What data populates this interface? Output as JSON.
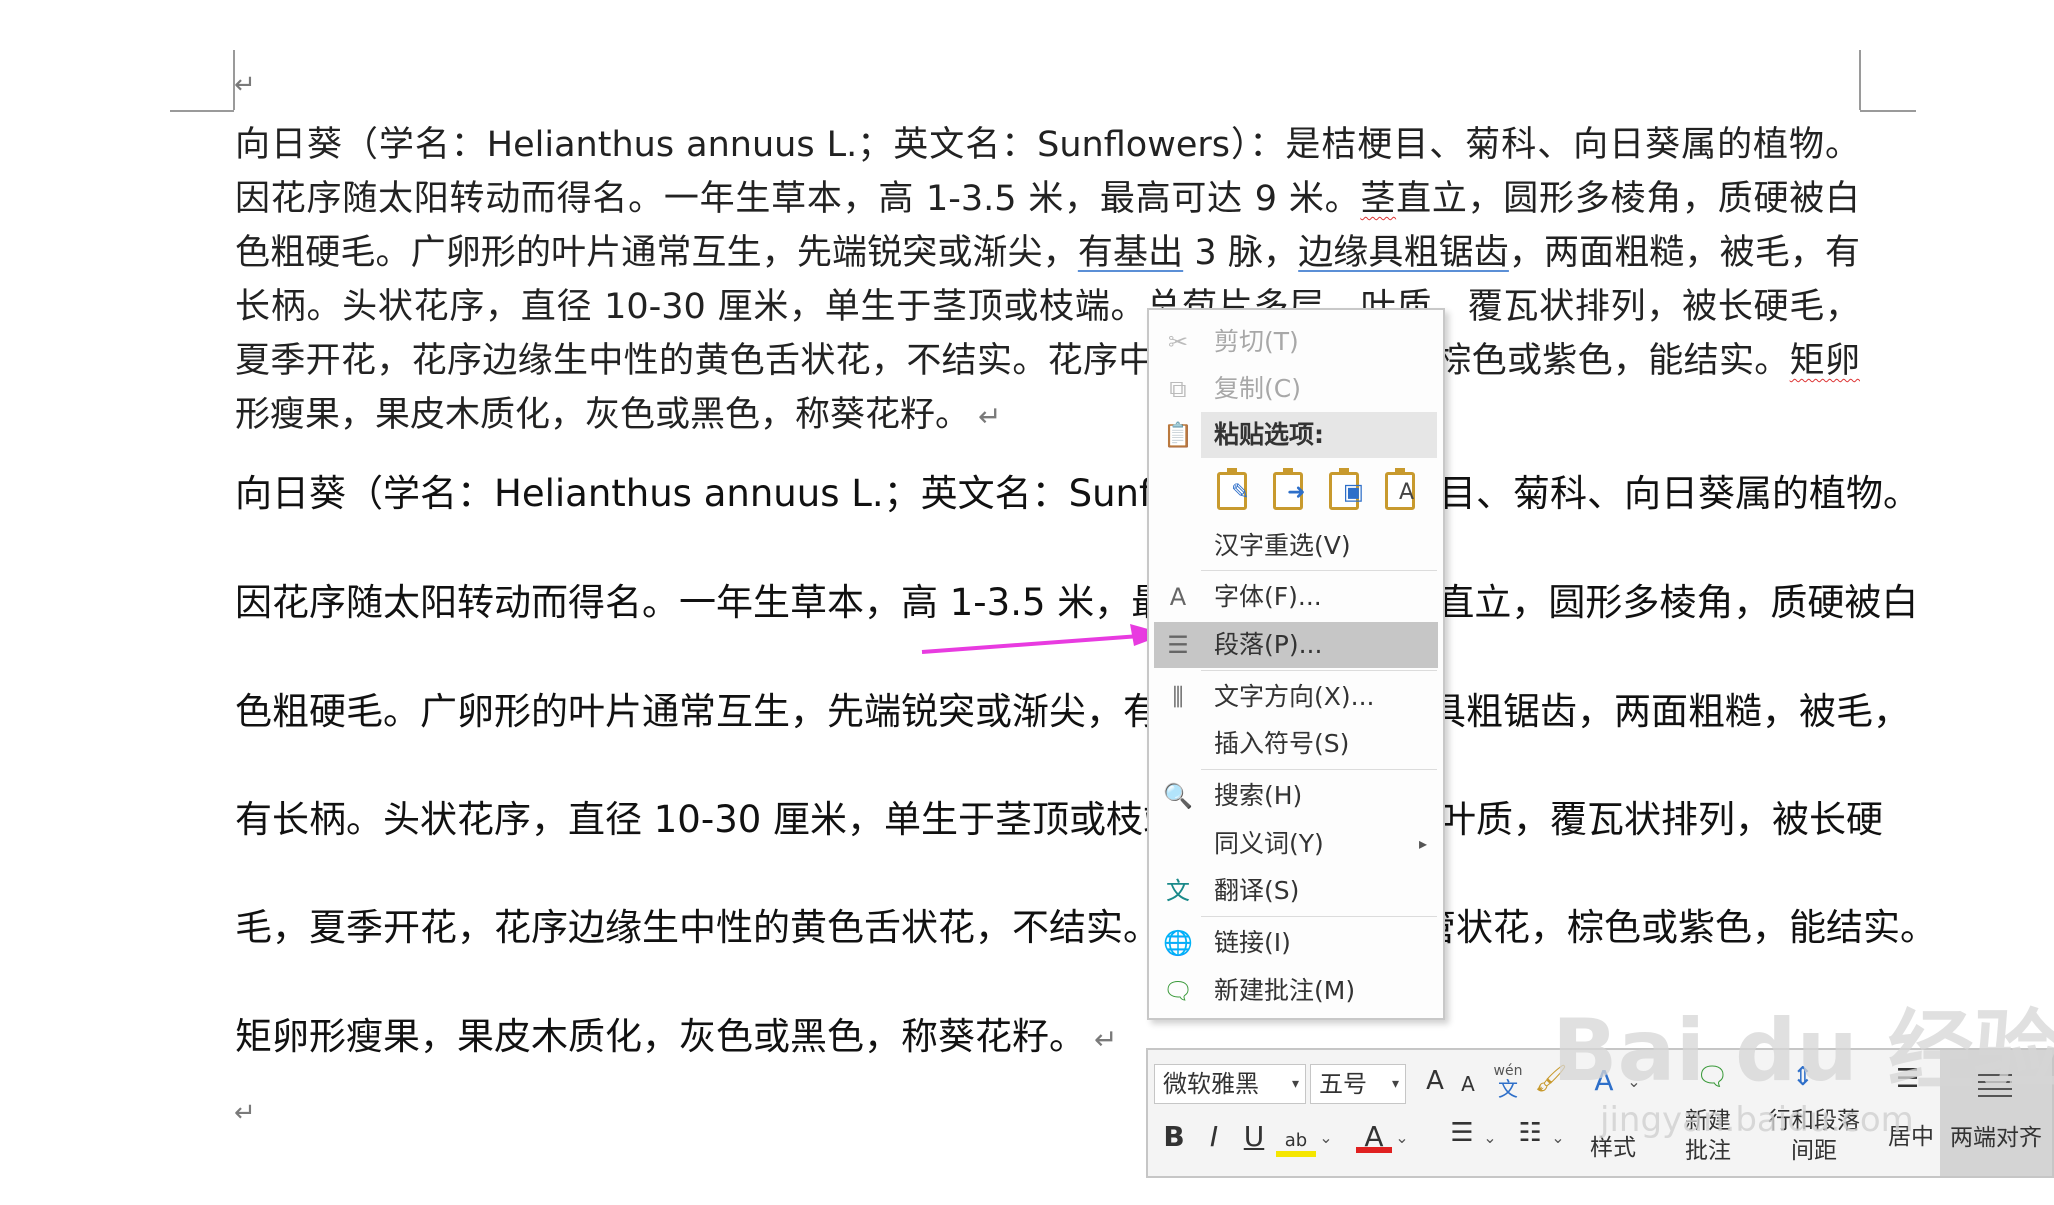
{
  "document": {
    "paragraph1": {
      "t1": "向日葵（学名：Helianthus annuus L.；英文名：Sunflowers）：是桔梗目、菊科、向日葵属的植物。因花序随太阳转动而得名。一年生草本，高 1-3.5 米，最高可达 9 米。",
      "t2": "茎",
      "t3": "直立，圆形多棱角，质硬被白色粗硬毛。广卵形的叶片通常互生，先端锐突或渐尖，",
      "t4": "有基出",
      "t5": " 3 脉，",
      "t6": "边缘具粗锯齿",
      "t7": "，两面粗糙，被毛，有长柄。头状花序，直径 10-30 厘米，单生于茎顶或枝端。总苞片多层，叶质，覆瓦状排列，被长硬毛，夏季开花，花序边缘生中性的黄色舌状花，不结实。花序中部为两性管状花，棕色或紫色，能结实。",
      "t8": "矩卵",
      "t9": "形瘦果，果皮木质化，灰色或黑色，称葵花籽。",
      "return_mark": "↵"
    },
    "paragraph2_lines": [
      "向日葵（学名：Helianthus annuus L.；英文名：Sunflowers）：是桔梗目、菊科、向日葵属的植物。",
      "因花序随太阳转动而得名。一年生草本，高 1-3.5 米，最高可达 9 米。茎直立，圆形多棱角，质硬被白",
      "色粗硬毛。广卵形的叶片通常互生，先端锐突或渐尖，有基出 3 脉，边缘具粗锯齿，两面粗糙，被毛，",
      "有长柄。头状花序，直径 10-30 厘米，单生于茎顶或枝端。总苞片多层，叶质，覆瓦状排列，被长硬",
      "毛，夏季开花，花序边缘生中性的黄色舌状花，不结实。花序中部为两性管状花，棕色或紫色，能结实。",
      "矩卵形瘦果，果皮木质化，灰色或黑色，称葵花籽。"
    ],
    "return_mark": "↵"
  },
  "context_menu": {
    "cut": "剪切(T)",
    "copy": "复制(C)",
    "paste_options": "粘贴选项:",
    "hanzi_reselect": "汉字重选(V)",
    "font": "字体(F)...",
    "paragraph": "段落(P)...",
    "text_direction": "文字方向(X)...",
    "insert_symbol": "插入符号(S)",
    "search": "搜索(H)",
    "synonyms": "同义词(Y)",
    "translate": "翻译(S)",
    "link": "链接(I)",
    "new_comment": "新建批注(M)",
    "submenu_arrow": "▸",
    "paste_text_only_glyph": "A"
  },
  "mini_toolbar": {
    "font_name": "微软雅黑",
    "font_size": "五号",
    "grow_font": "A",
    "shrink_font": "A",
    "phonetic_top": "wén",
    "phonetic_bottom": "文",
    "bold": "B",
    "italic": "I",
    "underline": "U",
    "highlight_glyph": "ab",
    "font_color": "A",
    "styles": "样式",
    "new_comment_l1": "新建",
    "new_comment_l2": "批注",
    "line_spacing_l1": "行和段落",
    "line_spacing_l2": "间距",
    "center": "居中",
    "justify": "两端对齐",
    "dropdown": "⌄"
  },
  "watermark": {
    "brand": "Bai du 经验",
    "url": "jingyan.baidu.com"
  },
  "colors": {
    "arrow": "#e83be0",
    "menu_highlight": "#c6c6c6",
    "highlight_yellow": "#f5e600",
    "font_color_red": "#e02020"
  }
}
